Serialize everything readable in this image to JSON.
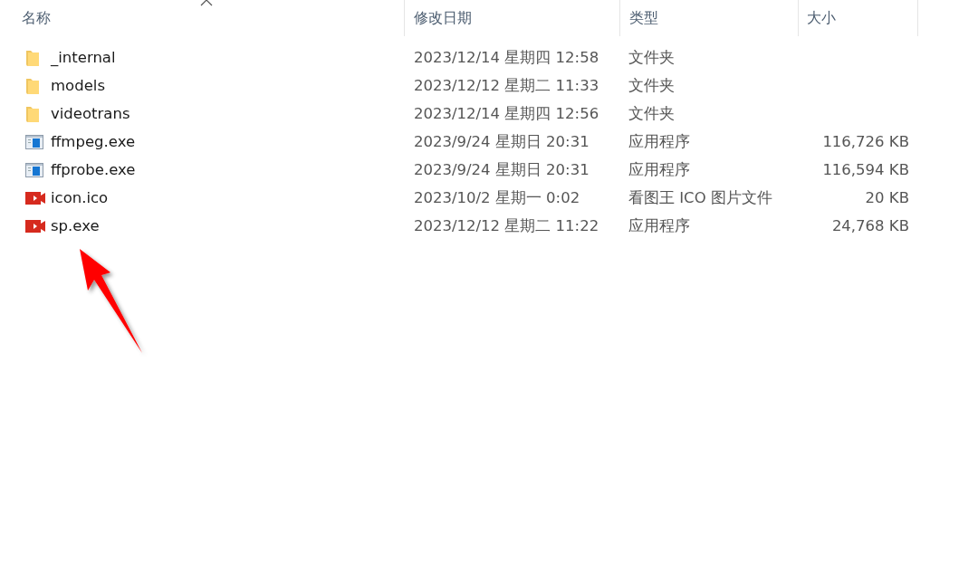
{
  "columns": [
    {
      "label": "名称",
      "sorted": true
    },
    {
      "label": "修改日期",
      "sorted": false
    },
    {
      "label": "类型",
      "sorted": false
    },
    {
      "label": "大小",
      "sorted": false
    }
  ],
  "files": [
    {
      "kind": "folder",
      "name": "_internal",
      "modified": "2023/12/14 星期四 12:58",
      "type": "文件夹"
    },
    {
      "kind": "folder",
      "name": "models",
      "modified": "2023/12/12 星期二 11:33",
      "type": "文件夹"
    },
    {
      "kind": "folder",
      "name": "videotrans",
      "modified": "2023/12/14 星期四 12:56",
      "type": "文件夹"
    },
    {
      "kind": "app",
      "name": "ffmpeg.exe",
      "modified": "2023/9/24 星期日 20:31",
      "type": "应用程序",
      "size": "116,726 KB"
    },
    {
      "kind": "app",
      "name": "ffprobe.exe",
      "modified": "2023/9/24 星期日 20:31",
      "type": "应用程序",
      "size": "116,594 KB"
    },
    {
      "kind": "video",
      "name": "icon.ico",
      "modified": "2023/10/2 星期一 0:02",
      "type": "看图王 ICO 图片文件",
      "size": "20 KB"
    },
    {
      "kind": "video",
      "name": "sp.exe",
      "modified": "2023/12/12 星期二 11:22",
      "type": "应用程序",
      "size": "24,768 KB"
    }
  ]
}
